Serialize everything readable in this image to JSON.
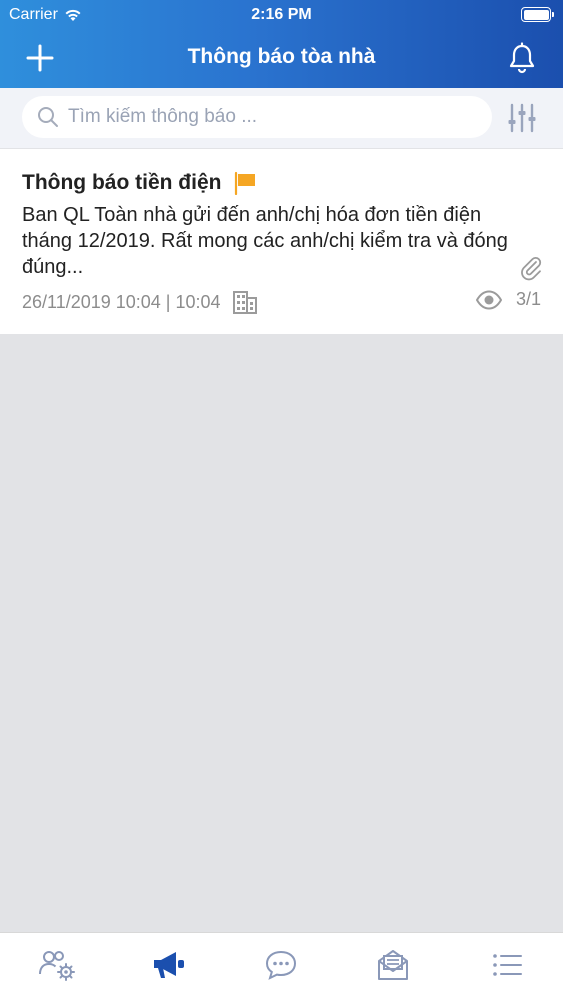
{
  "status_bar": {
    "carrier": "Carrier",
    "time": "2:16 PM",
    "wifi_icon": "wifi-icon",
    "battery_icon": "battery-icon"
  },
  "header": {
    "title": "Thông báo tòa nhà",
    "add_icon": "plus-icon",
    "bell_icon": "bell-icon",
    "gradient": [
      "#2f8fdc",
      "#2a73cf",
      "#1b4fae"
    ]
  },
  "search": {
    "placeholder": "Tìm kiếm thông báo ...",
    "value": "",
    "filter_icon": "sliders-icon"
  },
  "notifications": [
    {
      "title": "Thông báo tiền điện",
      "flag_color": "#f5a623",
      "body": "Ban QL Toàn nhà gửi đến anh/chị hóa đơn tiền điện tháng 12/2019. Rất mong các anh/chị kiểm tra và đóng đúng...",
      "date": "26/11/2019 10:04",
      "separator": " | ",
      "time": "10:04",
      "views": "3/1",
      "has_attachment": true
    }
  ],
  "tab_bar": {
    "active_color": "#1b4fae",
    "inactive_color": "#8a98b8",
    "tabs": [
      {
        "icon": "users-settings-icon",
        "active": false
      },
      {
        "icon": "megaphone-icon",
        "active": true
      },
      {
        "icon": "chat-icon",
        "active": false
      },
      {
        "icon": "mail-icon",
        "active": false
      },
      {
        "icon": "list-icon",
        "active": false
      }
    ]
  }
}
